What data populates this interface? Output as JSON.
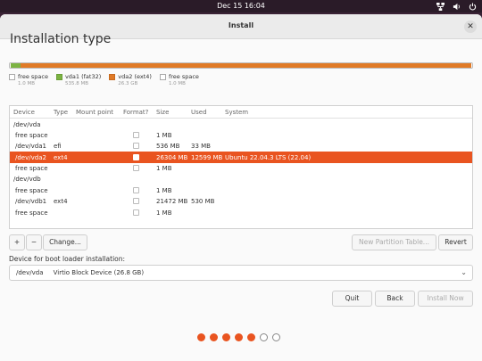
{
  "topbar": {
    "clock": "Dec 15  16:04"
  },
  "window": {
    "title": "Install"
  },
  "heading": "Installation type",
  "colors": {
    "accent": "#e95420",
    "fat32": "#7cb342",
    "ext4": "#e07a26",
    "free": "#ffffff"
  },
  "legend": [
    {
      "label": "free space",
      "size": "1.0 MB"
    },
    {
      "label": "vda1 (fat32)",
      "size": "535.8 MB"
    },
    {
      "label": "vda2 (ext4)",
      "size": "26.3 GB"
    },
    {
      "label": "free space",
      "size": "1.0 MB"
    }
  ],
  "table": {
    "headers": {
      "device": "Device",
      "type": "Type",
      "mount": "Mount point",
      "format": "Format?",
      "size": "Size",
      "used": "Used",
      "system": "System"
    },
    "rows": [
      {
        "device": "/dev/vda",
        "type": "",
        "size": "",
        "used": "",
        "system": "",
        "has_check": false,
        "selected": false,
        "indent": false
      },
      {
        "device": "free space",
        "type": "",
        "size": "1 MB",
        "used": "",
        "system": "",
        "has_check": true,
        "selected": false,
        "indent": true
      },
      {
        "device": "/dev/vda1",
        "type": "efi",
        "size": "536 MB",
        "used": "33 MB",
        "system": "",
        "has_check": true,
        "selected": false,
        "indent": true
      },
      {
        "device": "/dev/vda2",
        "type": "ext4",
        "size": "26304 MB",
        "used": "12599 MB",
        "system": "Ubuntu 22.04.3 LTS (22.04)",
        "has_check": true,
        "selected": true,
        "indent": true
      },
      {
        "device": "free space",
        "type": "",
        "size": "1 MB",
        "used": "",
        "system": "",
        "has_check": true,
        "selected": false,
        "indent": true
      },
      {
        "device": "/dev/vdb",
        "type": "",
        "size": "",
        "used": "",
        "system": "",
        "has_check": false,
        "selected": false,
        "indent": false
      },
      {
        "device": "free space",
        "type": "",
        "size": "1 MB",
        "used": "",
        "system": "",
        "has_check": true,
        "selected": false,
        "indent": true
      },
      {
        "device": "/dev/vdb1",
        "type": "ext4",
        "size": "21472 MB",
        "used": "530 MB",
        "system": "",
        "has_check": true,
        "selected": false,
        "indent": true
      },
      {
        "device": "free space",
        "type": "",
        "size": "1 MB",
        "used": "",
        "system": "",
        "has_check": true,
        "selected": false,
        "indent": true
      }
    ]
  },
  "toolbar": {
    "add": "+",
    "remove": "−",
    "change": "Change...",
    "new_table": "New Partition Table...",
    "revert": "Revert"
  },
  "boot": {
    "label": "Device for boot loader installation:",
    "value": "/dev/vda     Virtio Block Device (26.8 GB)"
  },
  "buttons": {
    "quit": "Quit",
    "back": "Back",
    "install": "Install Now"
  },
  "progress": {
    "total_steps": 7,
    "completed_steps": 5
  }
}
